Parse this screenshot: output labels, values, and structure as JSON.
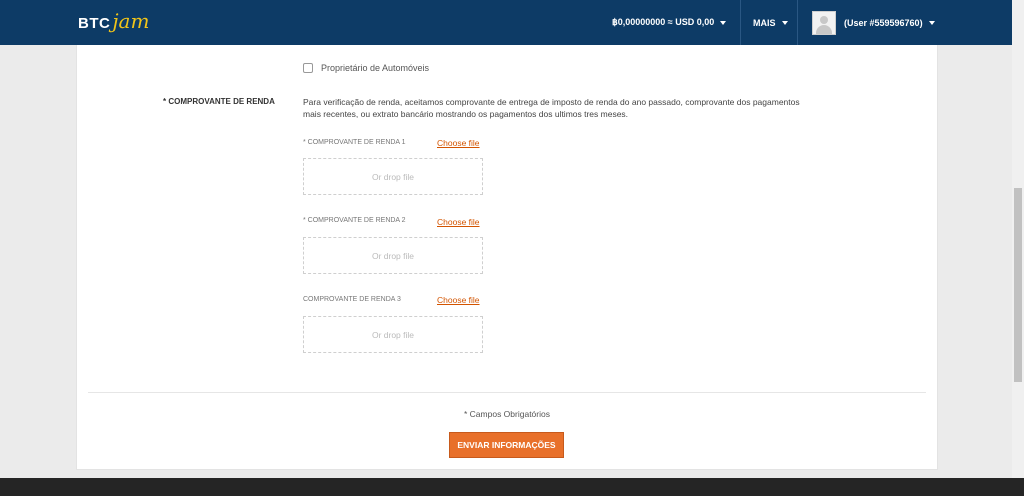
{
  "header": {
    "logo_btc": "BTC",
    "logo_jam": "jam",
    "balance": "฿0,00000000 ≈ USD 0,00",
    "more": "MAIS",
    "user": "(User #559596760)"
  },
  "form": {
    "checkbox_label": "Proprietário de Automóveis",
    "section_label": "* COMPROVANTE DE RENDA",
    "description": "Para verificação de renda, aceitamos comprovante de entrega de imposto de renda do ano passado, comprovante dos pagamentos mais recentes, ou extrato bancário mostrando os pagamentos dos ultimos tres meses.",
    "uploads": [
      {
        "label": "* COMPROVANTE DE RENDA 1",
        "choose": "Choose file",
        "drop": "Or drop file"
      },
      {
        "label": "* COMPROVANTE DE RENDA 2",
        "choose": "Choose file",
        "drop": "Or drop file"
      },
      {
        "label": "COMPROVANTE DE RENDA 3",
        "choose": "Choose file",
        "drop": "Or drop file"
      }
    ],
    "required_note": "* Campos Obrigatórios",
    "submit": "ENVIAR INFORMAÇÕES"
  },
  "colors": {
    "header_bg": "#0d3b66",
    "logo_accent": "#f0c419",
    "link": "#d35400",
    "button": "#e8702a"
  }
}
